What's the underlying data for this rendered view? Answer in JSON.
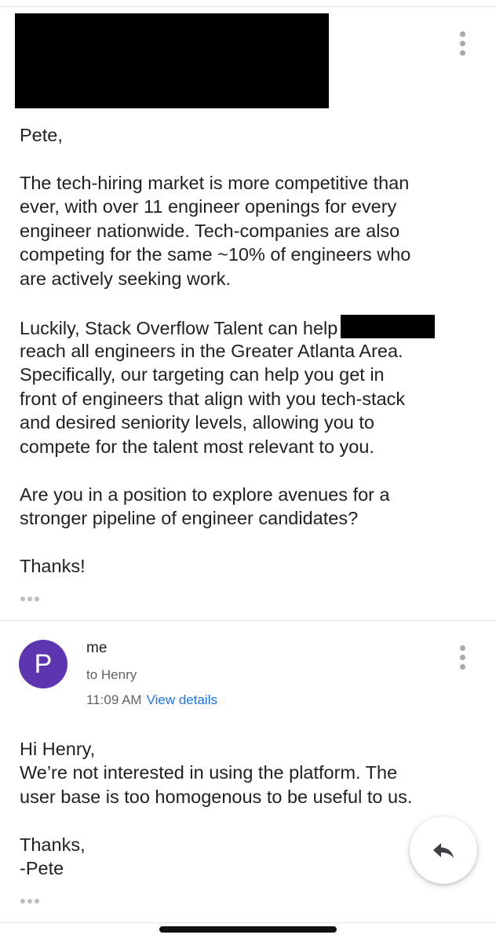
{
  "message1": {
    "sender_redacted": true,
    "greeting": "Pete,",
    "paragraphs": [
      [
        "The tech-hiring market is more competitive than",
        "ever, with over 11 engineer openings for every",
        "engineer nationwide. Tech-companies are also",
        "competing for the same ~10% of engineers who",
        "are actively seeking work."
      ],
      [
        "Luckily, Stack Overflow Talent can help",
        "reach all engineers in the Greater Atlanta Area.",
        "Specifically, our targeting can help you get in",
        "front of engineers that align with you tech-stack",
        "and desired seniority levels, allowing you to",
        "compete for the talent most relevant to you."
      ],
      [
        "Are you in a position to explore avenues for a",
        "stronger pipeline of engineer candidates?"
      ]
    ],
    "closing": "Thanks!",
    "more_options_icon": "more-vert-icon"
  },
  "message2": {
    "avatar_letter": "P",
    "avatar_color": "#5e35b1",
    "sender": "me",
    "recipient": "to Henry",
    "time": "11:09 AM",
    "view_details": "View details",
    "lines": [
      "Hi Henry,",
      "We’re not interested in using the platform. The",
      "user base is too homogenous to be useful to us."
    ],
    "signoff": [
      "Thanks,",
      "-Pete"
    ],
    "more_options_icon": "more-vert-icon"
  },
  "reply_button": {
    "icon": "reply-icon"
  },
  "colors": {
    "link": "#1a73e8",
    "text": "#202124",
    "secondary": "#5f6368"
  }
}
